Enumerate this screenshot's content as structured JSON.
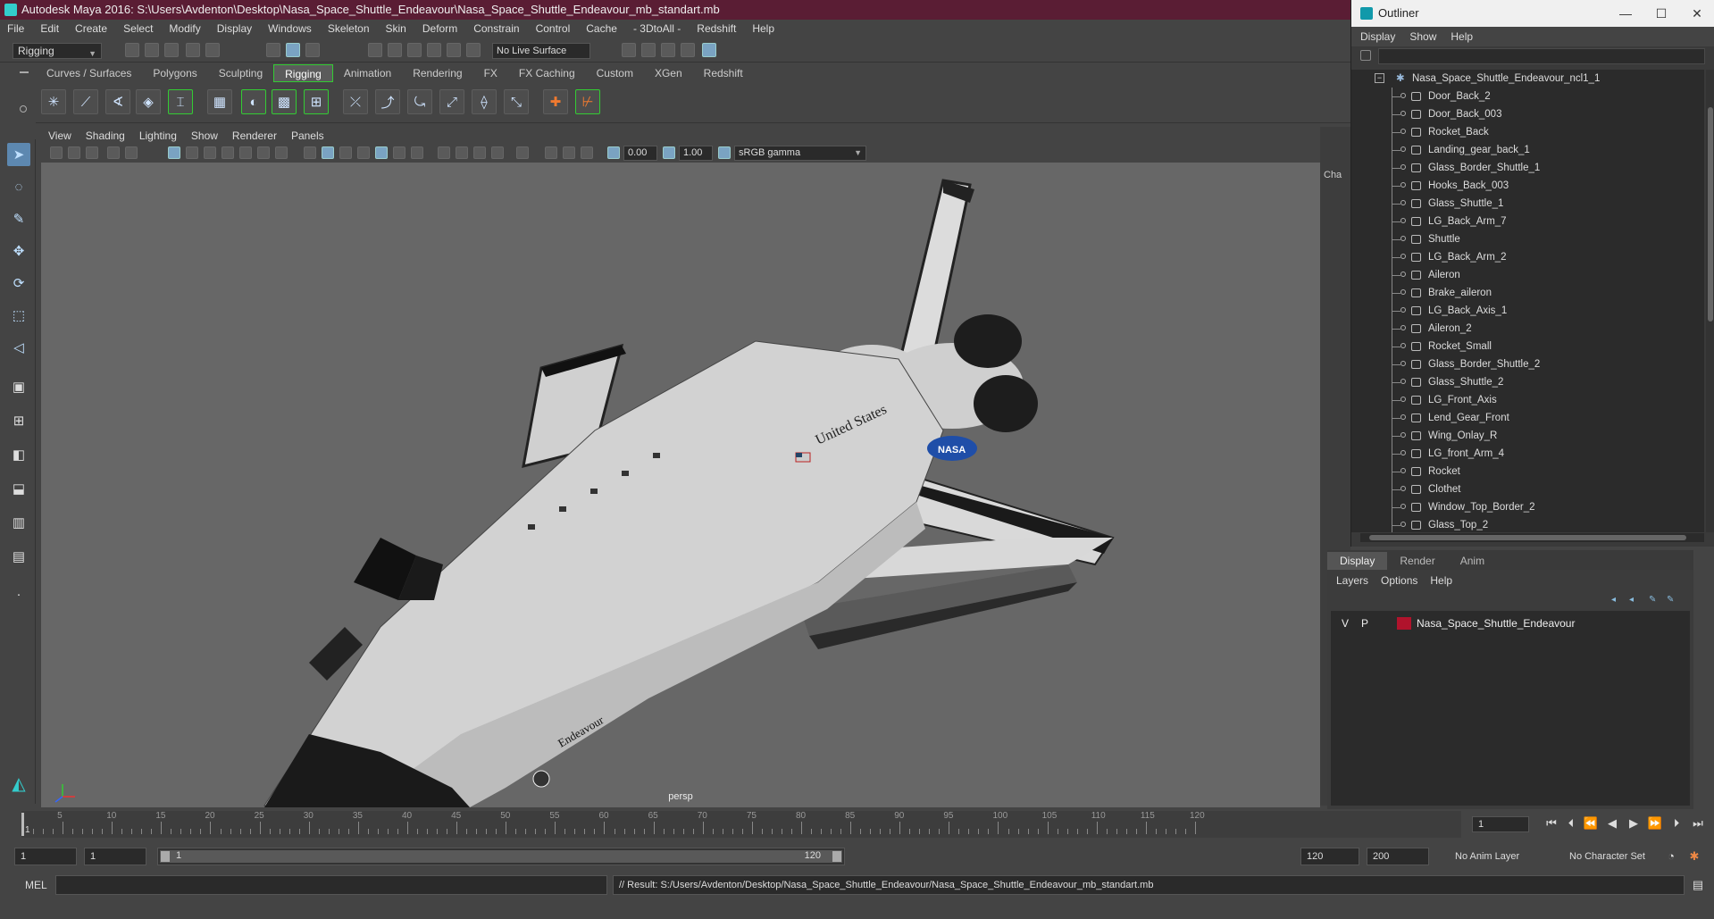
{
  "app": {
    "title": "Autodesk Maya 2016: S:\\Users\\Avdenton\\Desktop\\Nasa_Space_Shuttle_Endeavour\\Nasa_Space_Shuttle_Endeavour_mb_standart.mb"
  },
  "menu": [
    "File",
    "Edit",
    "Create",
    "Select",
    "Modify",
    "Display",
    "Windows",
    "Skeleton",
    "Skin",
    "Deform",
    "Constrain",
    "Control",
    "Cache",
    "- 3DtoAll -",
    "Redshift",
    "Help"
  ],
  "status": {
    "mode": "Rigging",
    "live_surface": "No Live Surface"
  },
  "shelf_tabs": [
    "Curves / Surfaces",
    "Polygons",
    "Sculpting",
    "Rigging",
    "Animation",
    "Rendering",
    "FX",
    "FX Caching",
    "Custom",
    "XGen",
    "Redshift"
  ],
  "shelf_active": "Rigging",
  "viewport": {
    "menu": [
      "View",
      "Shading",
      "Lighting",
      "Show",
      "Renderer",
      "Panels"
    ],
    "near_value": "0.00",
    "far_value": "1.00",
    "color_space": "sRGB gamma",
    "camera_label": "persp",
    "model_labels": {
      "country": "United States",
      "name": "Endeavour"
    }
  },
  "channel_box_label": "Cha",
  "outliner": {
    "title": "Outliner",
    "menu": [
      "Display",
      "Show",
      "Help"
    ],
    "root": "Nasa_Space_Shuttle_Endeavour_ncl1_1",
    "items": [
      "Door_Back_2",
      "Door_Back_003",
      "Rocket_Back",
      "Landing_gear_back_1",
      "Glass_Border_Shuttle_1",
      "Hooks_Back_003",
      "Glass_Shuttle_1",
      "LG_Back_Arm_7",
      "Shuttle",
      "LG_Back_Arm_2",
      "Aileron",
      "Brake_aileron",
      "LG_Back_Axis_1",
      "Aileron_2",
      "Rocket_Small",
      "Glass_Border_Shuttle_2",
      "Glass_Shuttle_2",
      "LG_Front_Axis",
      "Lend_Gear_Front",
      "Wing_Onlay_R",
      "LG_front_Arm_4",
      "Rocket",
      "Clothet",
      "Window_Top_Border_2",
      "Glass_Top_2"
    ]
  },
  "layers": {
    "tabs": [
      "Display",
      "Render",
      "Anim"
    ],
    "active_tab": "Display",
    "menu": [
      "Layers",
      "Options",
      "Help"
    ],
    "rows": [
      {
        "v": "V",
        "p": "P",
        "name": "Nasa_Space_Shuttle_Endeavour",
        "color": "#b0132c"
      }
    ]
  },
  "timeline": {
    "ticks": [
      "5",
      "10",
      "15",
      "20",
      "25",
      "30",
      "35",
      "40",
      "45",
      "50",
      "55",
      "60",
      "65",
      "70",
      "75",
      "80",
      "85",
      "90",
      "95",
      "100",
      "105",
      "110",
      "115",
      "120"
    ],
    "start_tick": "1",
    "current_frame": "1"
  },
  "range": {
    "start_field": "1",
    "start_field2": "1",
    "slider_start": "1",
    "slider_end": "120",
    "end_field": "120",
    "end_field2": "200",
    "anim_layer": "No Anim Layer",
    "char_set": "No Character Set"
  },
  "command": {
    "lang": "MEL",
    "result": "// Result: S:/Users/Avdenton/Desktop/Nasa_Space_Shuttle_Endeavour/Nasa_Space_Shuttle_Endeavour_mb_standart.mb"
  }
}
